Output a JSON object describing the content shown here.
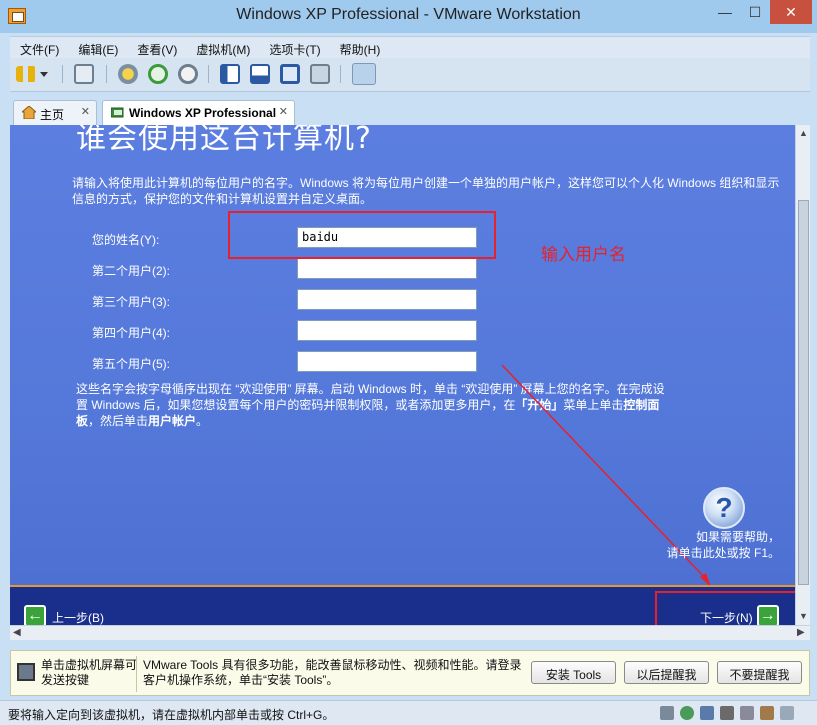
{
  "window": {
    "title": "Windows XP Professional - VMware Workstation",
    "min": "—",
    "max": "☐",
    "close": "✕"
  },
  "menu": [
    "文件(F)",
    "编辑(E)",
    "查看(V)",
    "虚拟机(M)",
    "选项卡(T)",
    "帮助(H)"
  ],
  "tabs": {
    "home": "主页",
    "vm": "Windows XP Professional",
    "close": "✕"
  },
  "vm_screen": {
    "heading": "谁会使用这台计算机?",
    "intro": "请输入将使用此计算机的每位用户的名字。Windows 将为每位用户创建一个单独的用户帐户，这样您可以个人化 Windows 组织和显示信息的方式，保护您的文件和计算机设置并自定义桌面。",
    "fields": [
      {
        "label": "您的姓名(Y):",
        "value": "baidu"
      },
      {
        "label": "第二个用户(2):",
        "value": ""
      },
      {
        "label": "第三个用户(3):",
        "value": ""
      },
      {
        "label": "第四个用户(4):",
        "value": ""
      },
      {
        "label": "第五个用户(5):",
        "value": ""
      }
    ],
    "note_1": "这些名字会按字母循序出现在 “欢迎使用” 屏幕。启动 Windows 时，单击 “欢迎使用” 屏幕上您的名字。在完成设置 Windows 后，如果您想设置每个用户的密码并限制权限，或者添加更多用户，在",
    "note_start": "「开始」",
    "note_2": "菜单上单击",
    "note_control": "控制面板",
    "note_3": "，然后单击",
    "note_accounts": "用户帐户",
    "note_4": "。",
    "annotation": "输入用户名",
    "help_icon": "?",
    "help_text_1": "如果需要帮助，",
    "help_text_2": "请单击此处或按 F1。",
    "back": "上一步(B)",
    "next": "下一步(N)",
    "back_arrow": "←",
    "next_arrow": "→"
  },
  "scroll": {
    "up": "▲",
    "down": "▼",
    "left": "◀",
    "right": "▶"
  },
  "hint": {
    "left": "单击虚拟机屏幕可发送按键",
    "message": "VMware Tools 具有很多功能，能改善鼠标移动性、视频和性能。请登录客户机操作系统，单击“安装 Tools”。",
    "install": "安装 Tools",
    "later": "以后提醒我",
    "never": "不要提醒我"
  },
  "status": "要将输入定向到该虚拟机，请在虚拟机内部单击或按 Ctrl+G。"
}
